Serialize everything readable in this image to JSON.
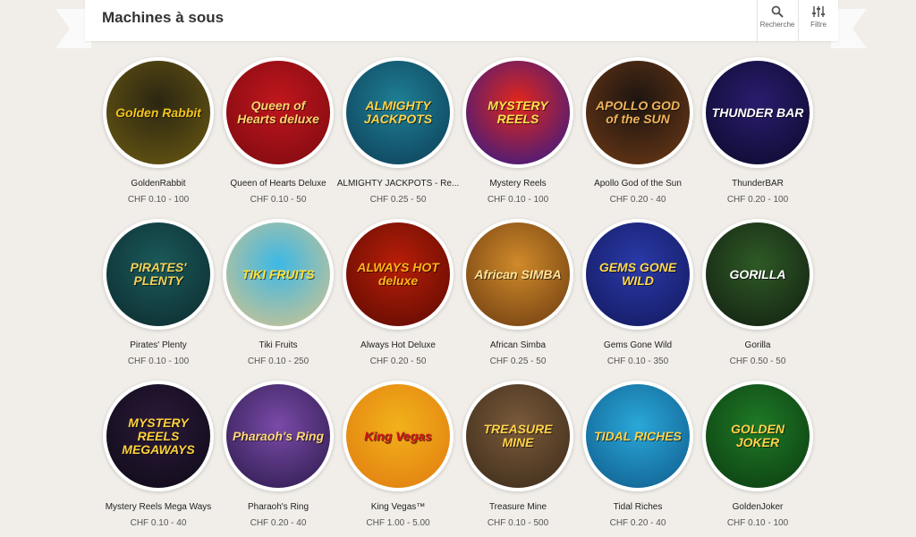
{
  "header": {
    "title": "Machines à sous",
    "search_label": "Recherche",
    "filter_label": "Filtre"
  },
  "games": [
    {
      "name": "GoldenRabbit",
      "price": "CHF 0.10 - 100",
      "logo": "Golden Rabbit",
      "bg": "#2b2612",
      "bg2": "#6b5a12",
      "fg": "#f3c41b"
    },
    {
      "name": "Queen of Hearts Deluxe",
      "price": "CHF 0.10 - 50",
      "logo": "Queen of Hearts deluxe",
      "bg": "#c0161d",
      "bg2": "#7a0a0f",
      "fg": "#ffd36b"
    },
    {
      "name": "ALMIGHTY JACKPOTS - Re...",
      "price": "CHF 0.25 - 50",
      "logo": "ALMIGHTY JACKPOTS",
      "bg": "#1e7f95",
      "bg2": "#0d3d55",
      "fg": "#ffd34a"
    },
    {
      "name": "Mystery Reels",
      "price": "CHF 0.10 - 100",
      "logo": "MYSTERY REELS",
      "bg": "#e2261b",
      "bg2": "#2a1a8c",
      "fg": "#ffe14a"
    },
    {
      "name": "Apollo God of the Sun",
      "price": "CHF 0.20 - 40",
      "logo": "APOLLO GOD of the SUN",
      "bg": "#1c1410",
      "bg2": "#6e3a16",
      "fg": "#f0b45a"
    },
    {
      "name": "ThunderBAR",
      "price": "CHF 0.20 - 100",
      "logo": "THUNDER BAR",
      "bg": "#2a1c6e",
      "bg2": "#0b0a2a",
      "fg": "#ffffff"
    },
    {
      "name": "Pirates' Plenty",
      "price": "CHF 0.10 - 100",
      "logo": "PIRATES' PLENTY",
      "bg": "#1b5a5a",
      "bg2": "#0c2a2e",
      "fg": "#f2d25a"
    },
    {
      "name": "Tiki Fruits",
      "price": "CHF 0.10 - 250",
      "logo": "TIKI FRUITS",
      "bg": "#3cb8e6",
      "bg2": "#d8c48a",
      "fg": "#ffe23a"
    },
    {
      "name": "Always Hot Deluxe",
      "price": "CHF 0.20 - 50",
      "logo": "ALWAYS HOT deluxe",
      "bg": "#b81e08",
      "bg2": "#5a0a02",
      "fg": "#ffb21a"
    },
    {
      "name": "African Simba",
      "price": "CHF 0.25 - 50",
      "logo": "African SIMBA",
      "bg": "#d08a2a",
      "bg2": "#6a3a10",
      "fg": "#ffe39a"
    },
    {
      "name": "Gems Gone Wild",
      "price": "CHF 0.10 - 350",
      "logo": "GEMS GONE WILD",
      "bg": "#2a3aa8",
      "bg2": "#12185c",
      "fg": "#ffd94a"
    },
    {
      "name": "Gorilla",
      "price": "CHF 0.50 - 50",
      "logo": "GORILLA",
      "bg": "#2e5a26",
      "bg2": "#121e10",
      "fg": "#ffffff"
    },
    {
      "name": "Mystery Reels Mega Ways",
      "price": "CHF 0.10 - 40",
      "logo": "MYSTERY REELS MEGAWAYS",
      "bg": "#2b1a3a",
      "bg2": "#0e0a16",
      "fg": "#ffd23a"
    },
    {
      "name": "Pharaoh's Ring",
      "price": "CHF 0.20 - 40",
      "logo": "Pharaoh's Ring",
      "bg": "#7a4aa8",
      "bg2": "#2a1a4a",
      "fg": "#ffd87a"
    },
    {
      "name": "King Vegas™",
      "price": "CHF 1.00 - 5.00",
      "logo": "King Vegas",
      "bg": "#f2b21a",
      "bg2": "#e07a10",
      "fg": "#d0141e"
    },
    {
      "name": "Treasure Mine",
      "price": "CHF 0.10 - 500",
      "logo": "TREASURE MINE",
      "bg": "#7a5a3a",
      "bg2": "#3a2a1a",
      "fg": "#ffd24a"
    },
    {
      "name": "Tidal Riches",
      "price": "CHF 0.20 - 40",
      "logo": "TIDAL RICHES",
      "bg": "#2aa8d8",
      "bg2": "#0e5a8a",
      "fg": "#ffd24a"
    },
    {
      "name": "GoldenJoker",
      "price": "CHF 0.10 - 100",
      "logo": "GOLDEN JOKER",
      "bg": "#1e7a26",
      "bg2": "#0c3a10",
      "fg": "#ffd24a"
    }
  ]
}
